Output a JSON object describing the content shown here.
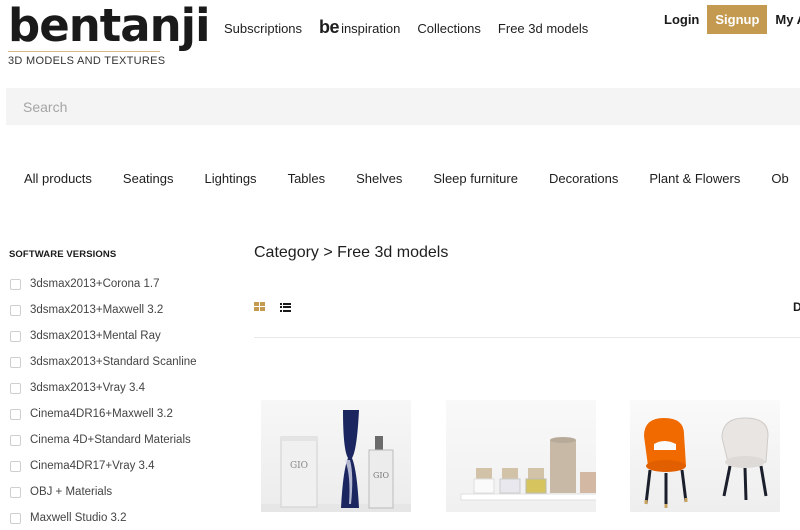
{
  "brand": {
    "name": "bentanji",
    "tagline": "3D MODELS AND TEXTURES"
  },
  "topnav": {
    "items": [
      {
        "label": "Subscriptions"
      },
      {
        "mark": "be",
        "label": "inspiration"
      },
      {
        "label": "Collections"
      },
      {
        "label": "Free 3d models"
      }
    ]
  },
  "auth": {
    "login": "Login",
    "signup": "Signup",
    "account": "My Ac"
  },
  "colors": {
    "accent": "#c49a50",
    "search_bg": "#f4f4f4"
  },
  "search": {
    "placeholder": "Search",
    "value": ""
  },
  "categories": [
    {
      "label": "All products"
    },
    {
      "label": "Seatings"
    },
    {
      "label": "Lightings"
    },
    {
      "label": "Tables"
    },
    {
      "label": "Shelves"
    },
    {
      "label": "Sleep furniture"
    },
    {
      "label": "Decorations"
    },
    {
      "label": "Plant & Flowers"
    },
    {
      "label": "Ob"
    }
  ],
  "sidebar": {
    "heading": "SOFTWARE VERSIONS",
    "filters": [
      {
        "label": "3dsmax2013+Corona 1.7",
        "checked": false
      },
      {
        "label": "3dsmax2013+Maxwell 3.2",
        "checked": false
      },
      {
        "label": "3dsmax2013+Mental Ray",
        "checked": false
      },
      {
        "label": "3dsmax2013+Standard Scanline",
        "checked": false
      },
      {
        "label": "3dsmax2013+Vray 3.4",
        "checked": false
      },
      {
        "label": "Cinema4DR16+Maxwell 3.2",
        "checked": false
      },
      {
        "label": "Cinema 4D+Standard Materials",
        "checked": false
      },
      {
        "label": "Cinema4DR17+Vray 3.4",
        "checked": false
      },
      {
        "label": "OBJ + Materials",
        "checked": false
      },
      {
        "label": "Maxwell Studio 3.2",
        "checked": false
      }
    ]
  },
  "main": {
    "breadcrumb": "Category > Free 3d models",
    "view": {
      "active": "grid",
      "grid_icon": "grid-view-icon",
      "list_icon": "list-view-icon"
    },
    "sort_peek": "D",
    "products": [
      {
        "alt": "Perfume bottles set (Acqua di Gio)"
      },
      {
        "alt": "Cosmetic jars and cylinder box set"
      },
      {
        "alt": "Orange and white velvet dining chairs"
      }
    ]
  }
}
